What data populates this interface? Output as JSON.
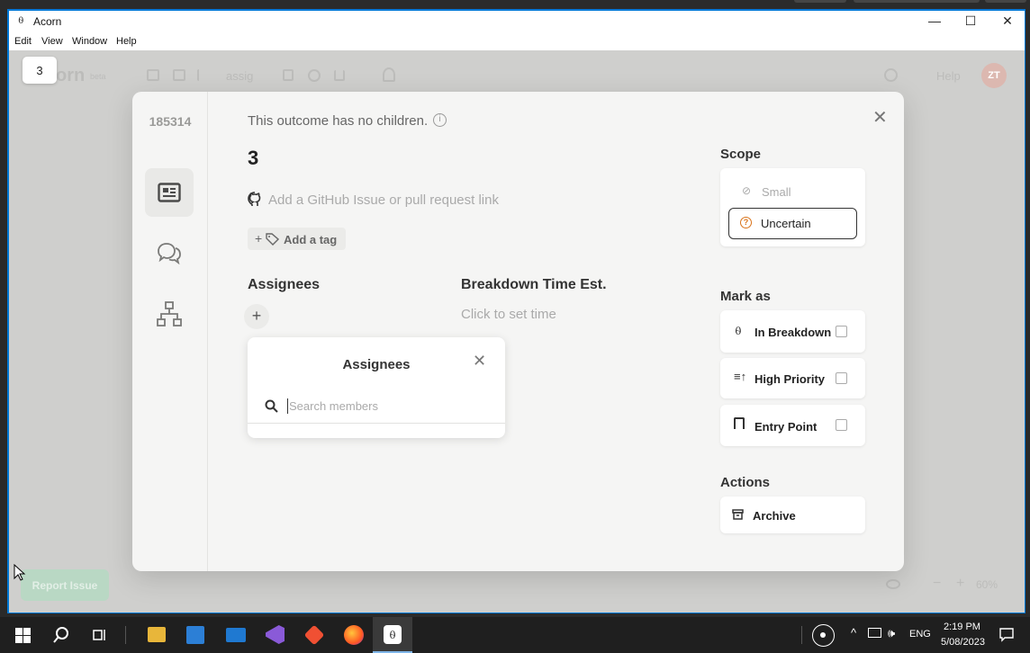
{
  "window": {
    "title": "Acorn",
    "min": "—",
    "max": "☐",
    "close": "✕"
  },
  "menu": [
    "Edit",
    "View",
    "Window",
    "Help"
  ],
  "background": {
    "logo": "orn",
    "logo_sub": "beta",
    "search_word": "assig",
    "help": "Help",
    "avatar_initials": "ZT",
    "report": "Report Issue",
    "zoom": "60%"
  },
  "badge": "3",
  "modal": {
    "id": "185314",
    "no_children": "This outcome has no children.",
    "title": "3",
    "github_placeholder": "Add a GitHub Issue or pull request link",
    "add_tag": "Add a tag",
    "assignees_heading": "Assignees",
    "breakdown_heading": "Breakdown Time Est.",
    "click_to_set": "Click to set time",
    "dropdown": {
      "title": "Assignees",
      "search_placeholder": "Search members"
    },
    "scope": {
      "heading": "Scope",
      "small": "Small",
      "uncertain": "Uncertain"
    },
    "mark_as": {
      "heading": "Mark as",
      "in_breakdown": "In Breakdown",
      "high_priority": "High Priority",
      "entry_point": "Entry Point"
    },
    "actions": {
      "heading": "Actions",
      "archive": "Archive"
    }
  },
  "taskbar": {
    "lang": "ENG",
    "time": "2:19 PM",
    "date": "5/08/2023"
  },
  "colors": {
    "window_border": "#0078d7",
    "scope_selected_icon": "#d9731a"
  }
}
